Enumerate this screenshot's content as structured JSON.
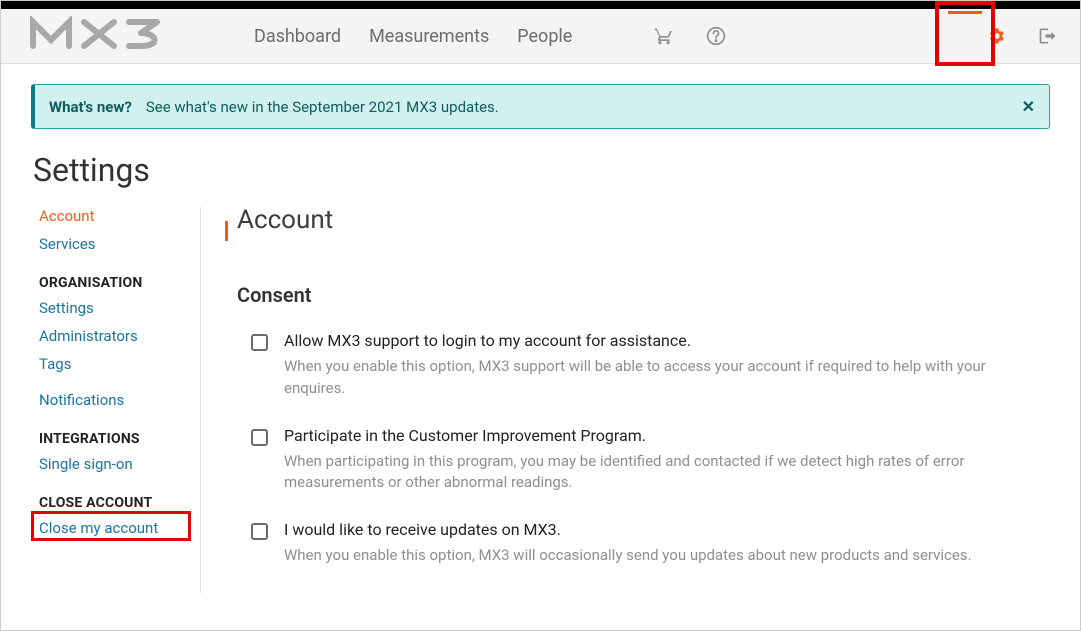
{
  "logo": "MX3",
  "nav": {
    "dashboard": "Dashboard",
    "measurements": "Measurements",
    "people": "People"
  },
  "alert": {
    "title": "What's new?",
    "message": "See what's new in the September 2021 MX3 updates.",
    "close_symbol": "✕"
  },
  "page_title": "Settings",
  "sidebar": {
    "account": "Account",
    "services": "Services",
    "org_head": "ORGANISATION",
    "settings": "Settings",
    "administrators": "Administrators",
    "tags": "Tags",
    "notifications": "Notifications",
    "int_head": "INTEGRATIONS",
    "sso": "Single sign-on",
    "close_head": "CLOSE ACCOUNT",
    "close_account": "Close my account"
  },
  "main": {
    "heading": "Account",
    "section": "Consent",
    "options": [
      {
        "label": "Allow MX3 support to login to my account for assistance.",
        "desc": "When you enable this option, MX3 support will be able to access your account if required to help with your enquires."
      },
      {
        "label": "Participate in the Customer Improvement Program.",
        "desc": "When participating in this program, you may be identified and contacted if we detect high rates of error measurements or other abnormal readings."
      },
      {
        "label": "I would like to receive updates on MX3.",
        "desc": "When you enable this option, MX3 will occasionally send you updates about new products and services."
      }
    ]
  },
  "colors": {
    "accent": "#f55b14",
    "teal": "#0e7c7c",
    "highlight": "#e60000"
  }
}
